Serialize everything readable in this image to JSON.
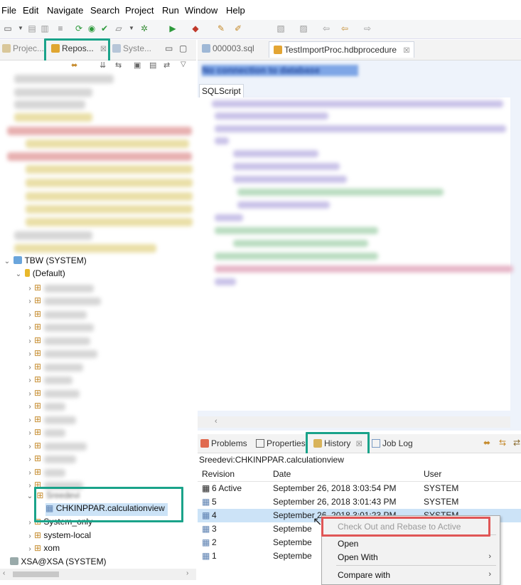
{
  "menu": [
    "File",
    "Edit",
    "Navigate",
    "Search",
    "Project",
    "Run",
    "Window",
    "Help"
  ],
  "left_tabs": [
    {
      "label": "Projec...",
      "icon": "project-explorer-icon"
    },
    {
      "label": "Repos...",
      "icon": "repository-icon",
      "close": "☒"
    },
    {
      "label": "Syste...",
      "icon": "systems-icon"
    }
  ],
  "tree": {
    "system_node": "TBW (SYSTEM)",
    "default_node": "(Default)",
    "package_node": "Sreedevi",
    "selected_item": "CHKINPPAR.calculationview",
    "system_only": "System_only",
    "system_local": "system-local",
    "xom": "xom",
    "xsa": "XSA@XSA (SYSTEM)"
  },
  "editor": {
    "tabs": [
      {
        "label": "000003.sql",
        "icon": "sql-file-icon"
      },
      {
        "label": "TestImportProc.hdbprocedure",
        "icon": "procedure-icon",
        "close": "☒"
      }
    ],
    "connection_banner": "No connection to database",
    "subtab": "SQLScript"
  },
  "bottom": {
    "tabs": [
      "Problems",
      "Properties",
      "History",
      "Job Log"
    ],
    "history_close": "☒",
    "path": "Sreedevi:CHKINPPAR.calculationview",
    "columns": [
      "Revision",
      "Date",
      "User"
    ],
    "rows": [
      {
        "rev": "6 Active",
        "date": "September 26, 2018 3:03:54 PM",
        "user": "SYSTEM"
      },
      {
        "rev": "5",
        "date": "September 26, 2018 3:01:43 PM",
        "user": "SYSTEM"
      },
      {
        "rev": "4",
        "date": "September 26, 2018 3:01:23 PM",
        "user": "SYSTEM"
      },
      {
        "rev": "3",
        "date": "Septembe",
        "user": ""
      },
      {
        "rev": "2",
        "date": "Septembe",
        "user": ""
      },
      {
        "rev": "1",
        "date": "Septembe",
        "user": ""
      }
    ]
  },
  "context_menu": {
    "items": [
      {
        "label": "Check Out and Rebase to Active",
        "enabled": false
      },
      {
        "label": "Open",
        "enabled": true
      },
      {
        "label": "Open With",
        "enabled": true,
        "submenu": "›"
      },
      {
        "label": "Compare with",
        "enabled": true,
        "submenu": "›"
      }
    ]
  },
  "colors": {
    "highlight_green": "#1aa38a",
    "highlight_red": "#e05656",
    "selection": "#cce3f7"
  }
}
